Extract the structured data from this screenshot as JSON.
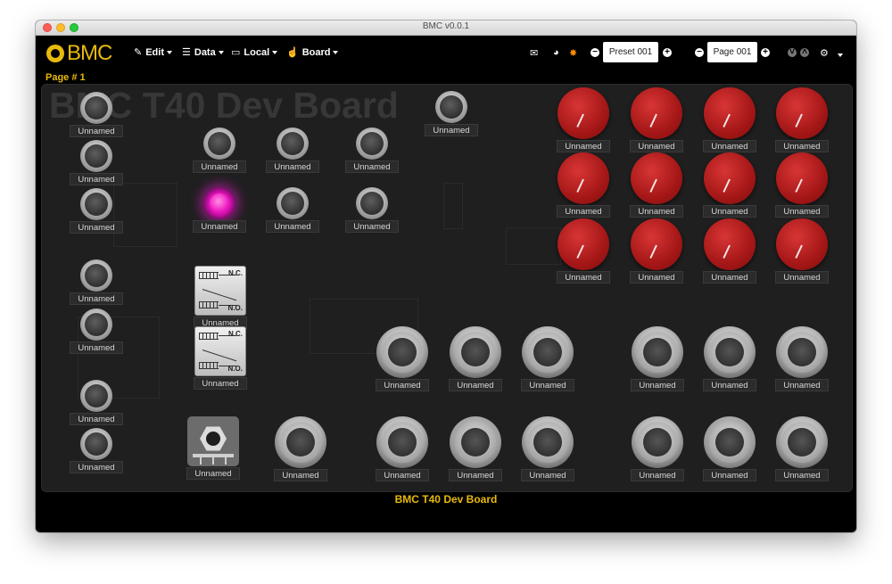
{
  "window": {
    "title": "BMC v0.0.1"
  },
  "navbar": {
    "logo": "BMC",
    "menus": [
      {
        "label": "Edit",
        "icon": "edit-icon"
      },
      {
        "label": "Data",
        "icon": "database-icon"
      },
      {
        "label": "Local",
        "icon": "monitor-icon"
      },
      {
        "label": "Board",
        "icon": "pointer-hand-icon"
      }
    ],
    "preset": "Preset 001",
    "page": "Page 001"
  },
  "page_label": "Page # 1",
  "board": {
    "watermark": "BMC T40 Dev Board",
    "footer": "BMC T40 Dev Board"
  },
  "component_label": "Unnamed",
  "colors": {
    "accent": "#e8b90c",
    "led_active": "#f020c4",
    "pot": "#a51717",
    "background": "#000000"
  }
}
